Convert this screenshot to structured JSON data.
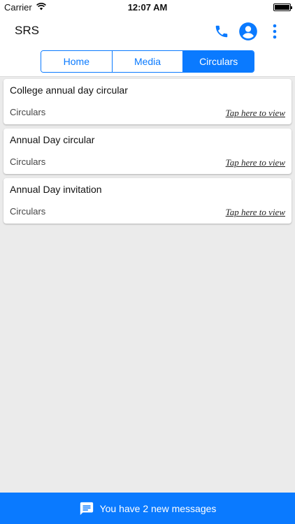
{
  "status_bar": {
    "carrier": "Carrier",
    "time": "12:07 AM"
  },
  "header": {
    "title": "SRS",
    "icons": [
      "phone-icon",
      "account-icon",
      "more-vert-icon"
    ],
    "accent_color": "#0a7aff"
  },
  "tabs": [
    {
      "label": "Home",
      "active": false
    },
    {
      "label": "Media",
      "active": false
    },
    {
      "label": "Circulars",
      "active": true
    }
  ],
  "circulars": [
    {
      "title": "College annual day circular",
      "category": "Circulars",
      "link": "Tap here to view"
    },
    {
      "title": "Annual Day circular",
      "category": "Circulars",
      "link": "Tap here to view"
    },
    {
      "title": "Annual Day invitation",
      "category": "Circulars",
      "link": "Tap here to view"
    }
  ],
  "bottom_bar": {
    "icon": "message-icon",
    "text": "You have 2 new messages"
  }
}
